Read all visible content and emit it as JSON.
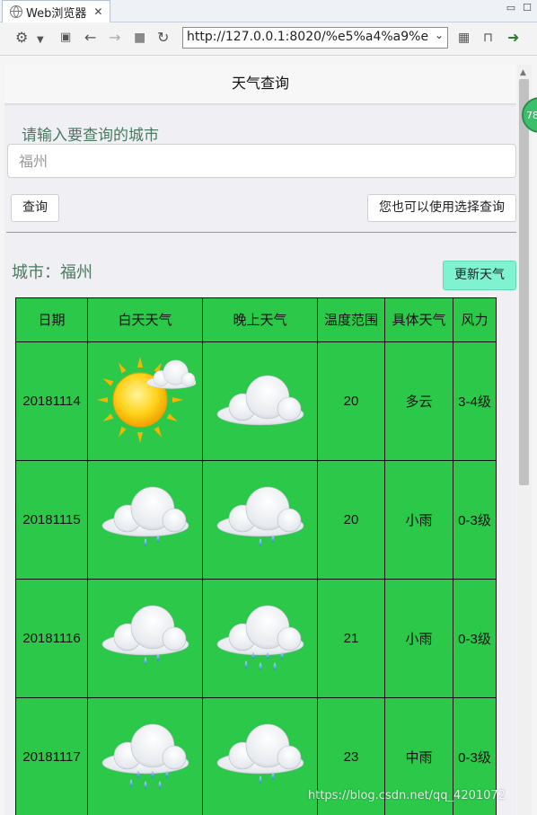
{
  "browser": {
    "tab_title": "Web浏览器",
    "url": "http://127.0.0.1:8020/%e5%a4%a9%e"
  },
  "app": {
    "title": "天气查询",
    "prompt": "请输入要查询的城市",
    "city_placeholder": "福州",
    "query_button": "查询",
    "select_button": "您也可以使用选择查询",
    "city_label": "城市：福州",
    "update_button": "更新天气",
    "badge": "78"
  },
  "table": {
    "headers": [
      "日期",
      "白天天气",
      "晚上天气",
      "温度范围",
      "具体天气",
      "风力"
    ],
    "rows": [
      {
        "date": "20181114",
        "day_icon": "sunny-cloudy-icon",
        "night_icon": "cloudy-icon",
        "temp": "20",
        "desc": "多云",
        "wind": "3-4级"
      },
      {
        "date": "20181115",
        "day_icon": "light-rain-icon",
        "night_icon": "light-rain-icon",
        "temp": "20",
        "desc": "小雨",
        "wind": "0-3级"
      },
      {
        "date": "20181116",
        "day_icon": "light-rain-icon",
        "night_icon": "moderate-rain-icon",
        "temp": "21",
        "desc": "小雨",
        "wind": "0-3级"
      },
      {
        "date": "20181117",
        "day_icon": "moderate-rain-icon",
        "night_icon": "light-rain-icon",
        "temp": "23",
        "desc": "中雨",
        "wind": "0-3级"
      }
    ]
  },
  "watermark": "https://blog.csdn.net/qq_4201072",
  "colors": {
    "table_bg": "#2bc84a",
    "accent_text": "#4a7a60",
    "update_button_bg": "#7ff3cf",
    "page_bg": "#efeff4"
  }
}
